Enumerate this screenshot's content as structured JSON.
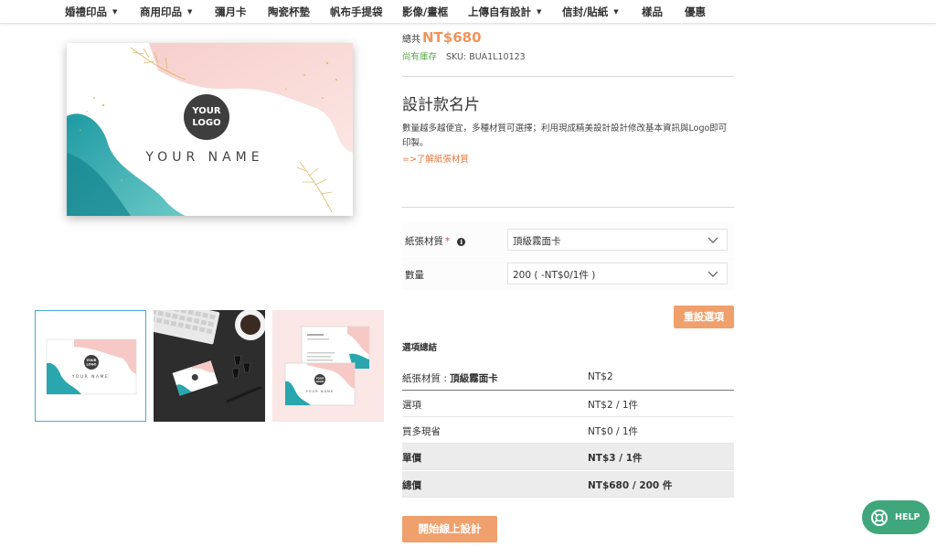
{
  "nav": {
    "items": [
      {
        "label": "婚禮印品",
        "caret": true
      },
      {
        "label": "商用印品",
        "caret": true
      },
      {
        "label": "彌月卡",
        "caret": false
      },
      {
        "label": "陶瓷杯墊",
        "caret": false
      },
      {
        "label": "帆布手提袋",
        "caret": false
      },
      {
        "label": "影像/畫框",
        "caret": false
      },
      {
        "label": "上傳自有設計",
        "caret": true
      },
      {
        "label": "信封/貼紙",
        "caret": true
      },
      {
        "label": "樣品",
        "caret": false
      },
      {
        "label": "優惠",
        "caret": false
      }
    ],
    "caret_glyph": "▼"
  },
  "gallery": {
    "card": {
      "logo_line1": "YOUR",
      "logo_line2": "LOGO",
      "name": "YOUR NAME"
    },
    "thumbs": [
      {
        "name": "card-front",
        "logo_line1": "YOUR",
        "logo_line2": "LOGO",
        "name_text": "YOUR NAME",
        "active": true
      },
      {
        "name": "desk-scene",
        "active": false
      },
      {
        "name": "card-pair",
        "logo_line1": "YOUR",
        "logo_line2": "LOGO",
        "name_text": "YOUR NAME",
        "active": false
      }
    ]
  },
  "product": {
    "total_label": "總共",
    "total_price": "NT$680",
    "stock_status": "尚有庫存",
    "sku": "SKU: BUA1L10123",
    "title": "設計款名片",
    "description": "數量越多越便宜，多種材質可選擇；利用現成精美設計設計修改基本資訊與Logo即可印製。",
    "paper_link": "=>了解紙張材質"
  },
  "options": {
    "paper": {
      "label": "紙張材質",
      "required_mark": "*",
      "info_glyph": "i",
      "value": "頂級霧面卡"
    },
    "quantity": {
      "label": "數量",
      "value": "200 ( -NT$0/1件 )"
    },
    "reset_label": "重設選項"
  },
  "summary": {
    "title": "選項總結",
    "rows": [
      {
        "label": "紙張材質 : ",
        "label_bold": "頂級霧面卡",
        "value": "NT$2"
      },
      {
        "label": "選項",
        "value": "NT$2 / 1件"
      },
      {
        "label": "買多現省",
        "value": "NT$0 / 1件"
      },
      {
        "label": "單價",
        "value": "NT$3 / 1件"
      },
      {
        "label": "總價",
        "value": "NT$680 / 200 件"
      }
    ]
  },
  "cta": {
    "start_design_label": "開始線上設計"
  },
  "help": {
    "label": "HELP"
  },
  "colors": {
    "accent": "#f0955c",
    "button": "#f0a06c",
    "stock_green": "#5aa84a",
    "help_green": "#3fa77b",
    "teal": "#2aa7ae",
    "blush": "#f4c4c4"
  }
}
